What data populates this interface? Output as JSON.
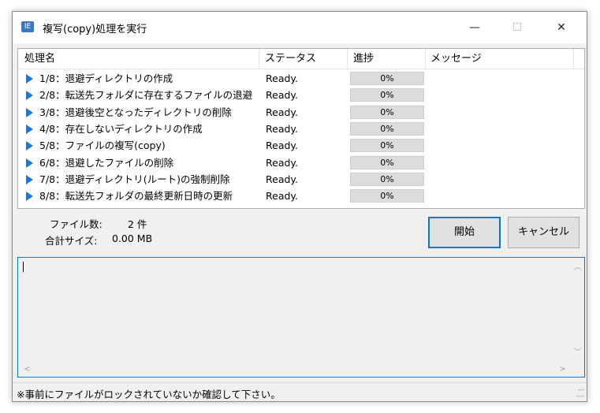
{
  "window": {
    "icon_label": "IE",
    "title": "複写(copy)処理を実行",
    "minimize": "—",
    "maximize": "☐",
    "close": "✕"
  },
  "list": {
    "columns": [
      "処理名",
      "ステータス",
      "進捗",
      "メッセージ"
    ],
    "rows": [
      {
        "name": "1/8：退避ディレクトリの作成",
        "status": "Ready.",
        "progress": "0%",
        "message": ""
      },
      {
        "name": "2/8：転送先フォルダに存在するファイルの退避",
        "status": "Ready.",
        "progress": "0%",
        "message": ""
      },
      {
        "name": "3/8：退避後空となったディレクトリの削除",
        "status": "Ready.",
        "progress": "0%",
        "message": ""
      },
      {
        "name": "4/8：存在しないディレクトリの作成",
        "status": "Ready.",
        "progress": "0%",
        "message": ""
      },
      {
        "name": "5/8：ファイルの複写(copy)",
        "status": "Ready.",
        "progress": "0%",
        "message": ""
      },
      {
        "name": "6/8：退避したファイルの削除",
        "status": "Ready.",
        "progress": "0%",
        "message": ""
      },
      {
        "name": "7/8：退避ディレクトリ(ルート)の強制削除",
        "status": "Ready.",
        "progress": "0%",
        "message": ""
      },
      {
        "name": "8/8：転送先フォルダの最終更新日時の更新",
        "status": "Ready.",
        "progress": "0%",
        "message": ""
      }
    ]
  },
  "summary": {
    "file_count_label": "ファイル数:",
    "file_count_value": "2 件",
    "total_size_label": "合計サイズ:",
    "total_size_value": "0.00 MB"
  },
  "buttons": {
    "start": "開始",
    "cancel": "キャンセル"
  },
  "log": {
    "value": "",
    "scroll_up": "︿",
    "scroll_down": "﹀",
    "scroll_left": "<",
    "scroll_right": ">"
  },
  "statusbar": {
    "text": "※事前にファイルがロックされていないか確認して下さい。"
  },
  "colors": {
    "accent": "#0078d7",
    "arrow": "#1a78d6",
    "progress_track": "#dcdcdc",
    "progress_fill": "#06b025"
  },
  "icons": [
    "app-icon",
    "minimize-icon",
    "maximize-icon",
    "close-icon",
    "play-arrow-icon",
    "size-grip-icon"
  ]
}
